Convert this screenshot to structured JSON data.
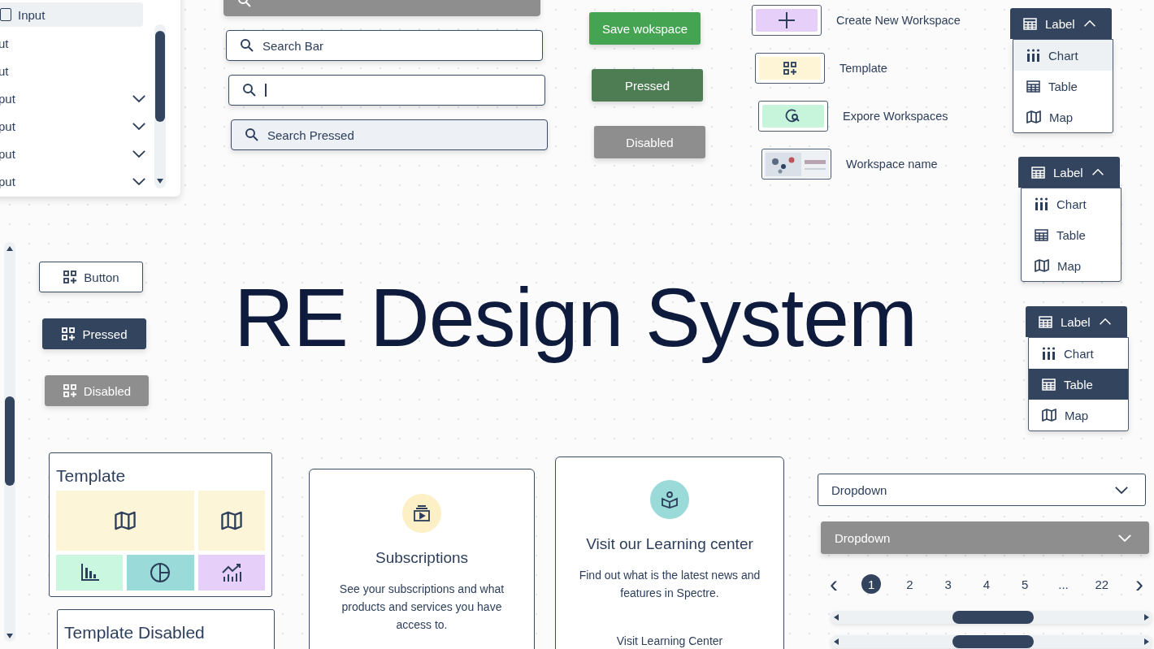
{
  "title": "RE Design System",
  "tree_list": {
    "items": [
      {
        "label": "Input",
        "kind": "checkbox",
        "checked": false,
        "selected": true
      },
      {
        "label": "ut",
        "kind": "plain",
        "selected": false
      },
      {
        "label": "ut",
        "kind": "plain",
        "selected": false
      },
      {
        "label": "put",
        "kind": "group",
        "selected": false
      },
      {
        "label": "put",
        "kind": "group",
        "selected": false
      },
      {
        "label": "put",
        "kind": "group",
        "selected": false
      },
      {
        "label": "put",
        "kind": "group",
        "selected": false
      }
    ]
  },
  "search_bars": [
    {
      "disabled": true,
      "focused": false,
      "pressed": false
    },
    {
      "disabled": false,
      "focused": false,
      "pressed": false,
      "placeholder": "Search Bar"
    },
    {
      "disabled": false,
      "focused": true,
      "pressed": false
    },
    {
      "disabled": false,
      "focused": false,
      "pressed": true,
      "placeholder": "Search Pressed"
    }
  ],
  "action_buttons": [
    {
      "label": "Save wokspace",
      "pressed": false,
      "disabled": false
    },
    {
      "label": "Pressed",
      "pressed": true,
      "disabled": false
    },
    {
      "label": "Disabled",
      "pressed": false,
      "disabled": true
    }
  ],
  "workspace_tiles": [
    {
      "label": "Create New Workspace",
      "kind": "create",
      "color": "#e6cff8"
    },
    {
      "label": "Template",
      "kind": "template",
      "color": "#fdf5d6"
    },
    {
      "label": "Expore Workspaces",
      "kind": "explore",
      "color": "#c6f5dc"
    },
    {
      "label": "Workspace name",
      "kind": "picture"
    }
  ],
  "view_menus": [
    {
      "label": "Label",
      "expanded": true,
      "options": [
        {
          "label": "Chart",
          "kind": "chart",
          "hovered": true,
          "selected": false
        },
        {
          "label": "Table",
          "kind": "table",
          "hovered": false,
          "selected": false
        },
        {
          "label": "Map",
          "kind": "map",
          "hovered": false,
          "selected": false
        }
      ]
    },
    {
      "label": "Label",
      "expanded": true,
      "options": [
        {
          "label": "Chart",
          "kind": "chart",
          "hovered": false,
          "selected": false
        },
        {
          "label": "Table",
          "kind": "table",
          "hovered": false,
          "selected": false
        },
        {
          "label": "Map",
          "kind": "map",
          "hovered": false,
          "selected": false
        }
      ]
    },
    {
      "label": "Label",
      "expanded": true,
      "options": [
        {
          "label": "Chart",
          "kind": "chart",
          "hovered": false,
          "selected": false
        },
        {
          "label": "Table",
          "kind": "table",
          "hovered": false,
          "selected": true
        },
        {
          "label": "Map",
          "kind": "map",
          "hovered": false,
          "selected": false
        }
      ]
    }
  ],
  "icon_buttons": [
    {
      "label": "Button",
      "pressed": false,
      "disabled": false
    },
    {
      "label": "Pressed",
      "pressed": true,
      "disabled": false
    },
    {
      "label": "Disabled",
      "pressed": false,
      "disabled": true
    }
  ],
  "template_card": {
    "title": "Template",
    "tiles": [
      {
        "kind": "map",
        "color": "#fdf5d8"
      },
      {
        "kind": "map",
        "color": "#fdf5d8"
      },
      {
        "kind": "bar_chart",
        "color": "#c9f7df"
      },
      {
        "kind": "pie_chart",
        "color": "#9adad8"
      },
      {
        "kind": "line_chart",
        "color": "#e6cff8"
      }
    ]
  },
  "template_disabled_card": {
    "title": "Template Disabled"
  },
  "info_cards": [
    {
      "kind": "subscriptions",
      "color": "#fdf0c6",
      "title": "Subscriptions",
      "text": "See your subscriptions and what products and services you have access to."
    },
    {
      "kind": "learning",
      "color": "#9adad8",
      "title": "Visit our Learning center",
      "text": "Find out what is the latest news and features in Spectre.",
      "link": "Visit Learning Center"
    }
  ],
  "dropdowns": [
    {
      "label": "Dropdown",
      "disabled": false
    },
    {
      "label": "Dropdown",
      "disabled": true
    }
  ],
  "pagination": {
    "previous": "‹",
    "next": "›",
    "pages": [
      {
        "label": "1",
        "selected": true
      },
      {
        "label": "2",
        "selected": false
      },
      {
        "label": "3",
        "selected": false
      },
      {
        "label": "4",
        "selected": false
      },
      {
        "label": "5",
        "selected": false
      },
      {
        "label": "...",
        "selected": false
      },
      {
        "label": "22",
        "selected": false
      }
    ]
  }
}
